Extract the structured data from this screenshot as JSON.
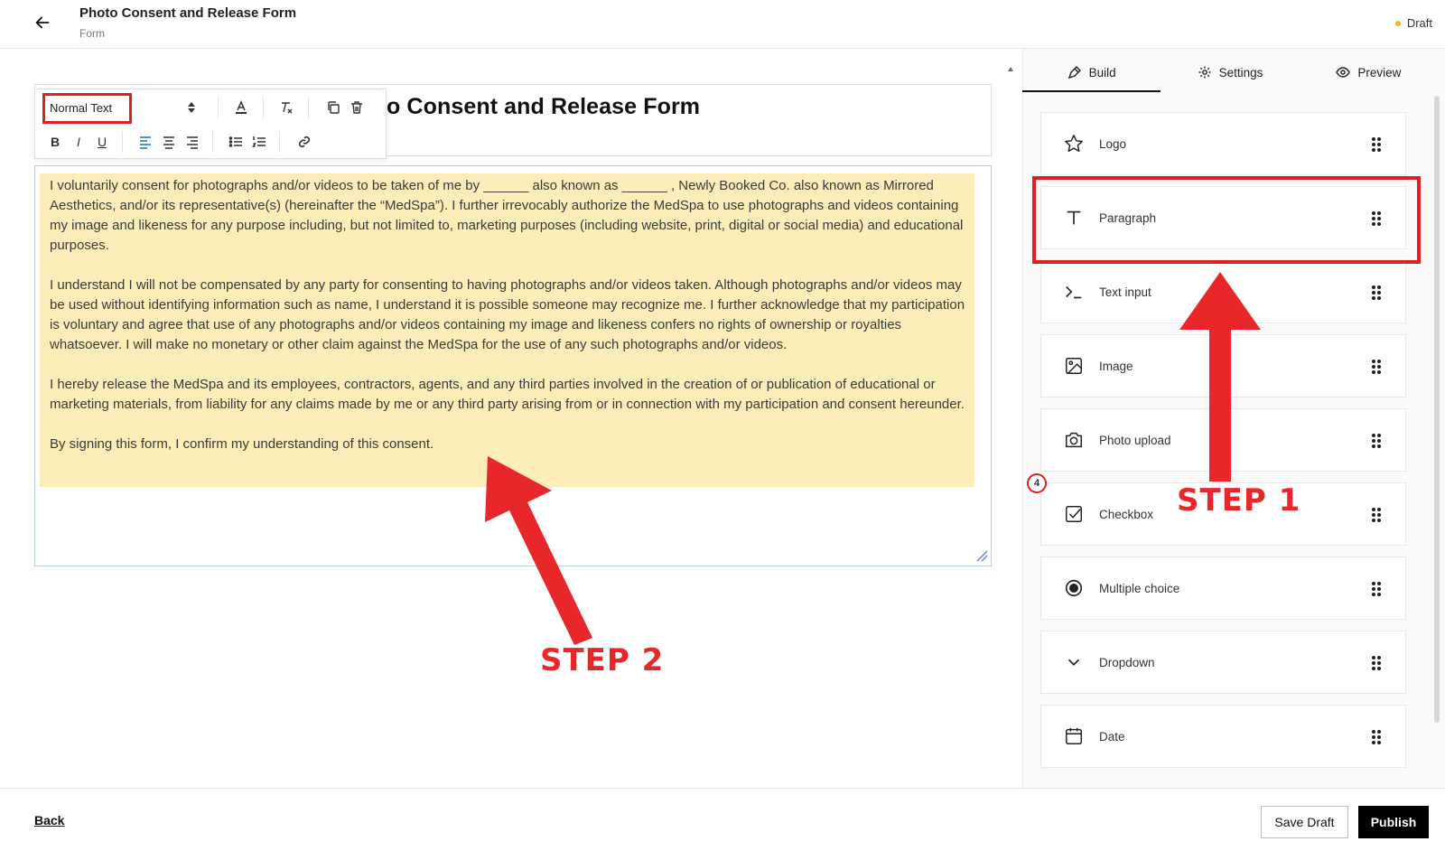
{
  "header": {
    "title": "Photo Consent and Release Form",
    "subtitle": "Form",
    "status": "Draft"
  },
  "editor": {
    "heading": "o Consent and Release Form",
    "toolbar": {
      "text_style": "Normal Text"
    },
    "paragraphs": [
      "I voluntarily consent for photographs and/or videos to be taken of me by ______ also known as ______ , Newly Booked Co. also known as Mirrored Aesthetics, and/or its representative(s) (hereinafter the “MedSpa”). I further irrevocably authorize the MedSpa to use photographs and videos containing my image and likeness for any purpose including, but not limited to, marketing purposes (including website, print, digital or social media) and educational purposes.",
      "I understand I will not be compensated by any party for consenting to having photographs and/or videos taken. Although photographs and/or videos may be used without identifying information such as name, I understand it is possible someone may recognize me. I further acknowledge that my participation is voluntary and agree that use of any photographs and/or videos containing my image and likeness confers no rights of ownership or royalties whatsoever. I will make no monetary or other claim against the MedSpa for the use of any such photographs and/or videos.",
      "I hereby release the MedSpa and its employees, contractors, agents, and any third parties involved in the creation of or publication of educational or marketing materials, from liability for any claims made by me or any third party arising from or in connection with my participation and consent hereunder.",
      "By signing this form, I confirm my understanding of this consent."
    ]
  },
  "panel": {
    "tabs": [
      {
        "label": "Build",
        "icon": "pen-icon",
        "active": true
      },
      {
        "label": "Settings",
        "icon": "gear-icon",
        "active": false
      },
      {
        "label": "Preview",
        "icon": "eye-icon",
        "active": false
      }
    ],
    "components": [
      {
        "label": "Logo",
        "icon": "star-icon"
      },
      {
        "label": "Paragraph",
        "icon": "text-t-icon"
      },
      {
        "label": "Text input",
        "icon": "terminal-icon"
      },
      {
        "label": "Image",
        "icon": "image-icon"
      },
      {
        "label": "Photo upload",
        "icon": "camera-icon"
      },
      {
        "label": "Checkbox",
        "icon": "checkbox-icon"
      },
      {
        "label": "Multiple choice",
        "icon": "radio-icon"
      },
      {
        "label": "Dropdown",
        "icon": "chevron-down-icon"
      },
      {
        "label": "Date",
        "icon": "calendar-icon"
      }
    ]
  },
  "annotations": {
    "step1": "STEP 1",
    "step2": "STEP 2",
    "badge": "4",
    "accent_color": "#e8272a"
  },
  "footer": {
    "back": "Back",
    "save_draft": "Save Draft",
    "publish": "Publish"
  }
}
